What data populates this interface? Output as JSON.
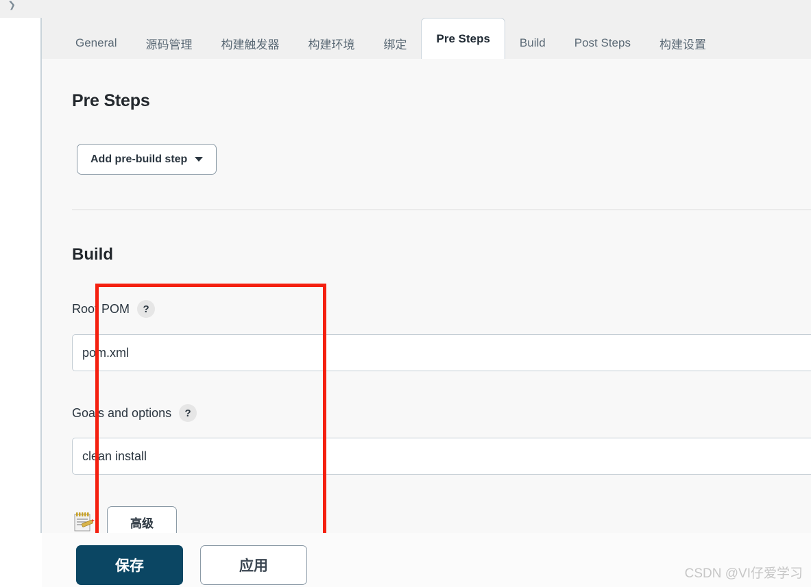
{
  "window": {
    "background_color": "#f8f8f8",
    "breadcrumb_icon": "chevron-right-icon"
  },
  "tabs": [
    {
      "label": "General",
      "active": false
    },
    {
      "label": "源码管理",
      "active": false
    },
    {
      "label": "构建触发器",
      "active": false
    },
    {
      "label": "构建环境",
      "active": false
    },
    {
      "label": "绑定",
      "active": false
    },
    {
      "label": "Pre Steps",
      "active": true
    },
    {
      "label": "Build",
      "active": false
    },
    {
      "label": "Post Steps",
      "active": false
    },
    {
      "label": "构建设置",
      "active": false
    }
  ],
  "main": {
    "page_title": "Pre Steps",
    "add_step_button": "Add pre-build step",
    "add_step_caret": "chevron-down-icon",
    "section": {
      "title": "Build",
      "fields": [
        {
          "label": "Root POM",
          "help": "?",
          "value": "pom.xml",
          "placeholder": "pom.xml"
        },
        {
          "label": "Goals and options",
          "help": "?",
          "value": "clean install",
          "placeholder": ""
        }
      ],
      "advanced_button": "高级",
      "notepad_icon": "notepad-pencil-icon"
    }
  },
  "annotation": {
    "color": "#f42010",
    "shape": "rectangle"
  },
  "bottom_bar": {
    "save_label": "保存",
    "apply_label": "应用",
    "save_color": "#0b4663"
  },
  "watermark": {
    "text": "CSDN @VI仔爱学习"
  }
}
